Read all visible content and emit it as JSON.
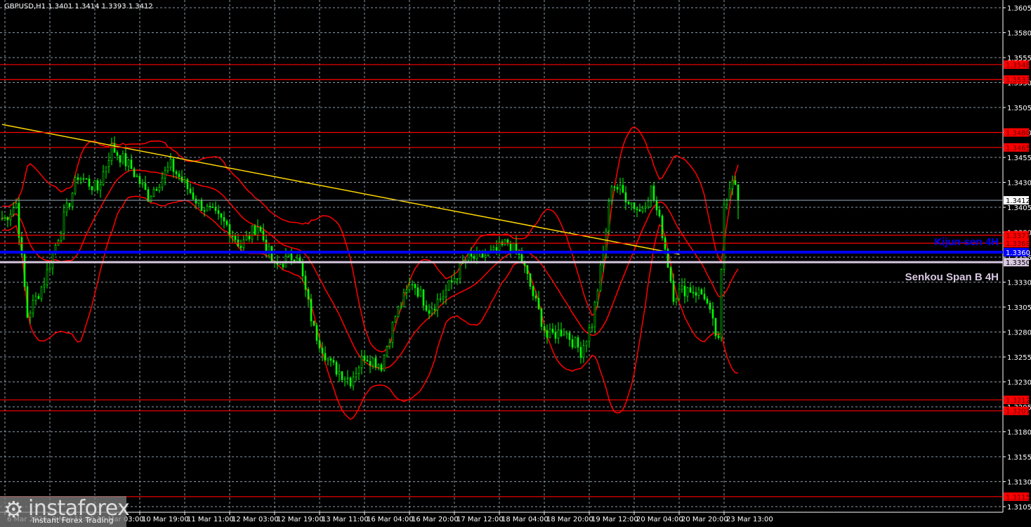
{
  "header": {
    "symbol_line": "GBPUSD,H1  1.3401 1.3414 1.3393 1.3412"
  },
  "logo": {
    "name": "instaforex",
    "tagline": "Instant Forex Trading"
  },
  "chart_data": {
    "type": "candlestick",
    "symbol": "GBPUSD",
    "timeframe": "H1",
    "ohlc_last": {
      "open": 1.3401,
      "high": 1.3414,
      "low": 1.3393,
      "close": 1.3412
    },
    "ylim": [
      1.3097,
      1.362
    ],
    "y_ticks": [
      "1.3605",
      "1.3580",
      "1.3555",
      "1.3530",
      "1.3505",
      "1.3480",
      "1.3455",
      "1.3430",
      "1.3405",
      "1.3380",
      "1.3355",
      "1.3330",
      "1.3305",
      "1.3280",
      "1.3255",
      "1.3230",
      "1.3205",
      "1.3180",
      "1.3155",
      "1.3130",
      "1.3105"
    ],
    "x_ticks": [
      "6 Mar 2026",
      "9 Mar 11:00",
      "10 Mar 03:00",
      "10 Mar 19:00",
      "11 Mar 11:00",
      "12 Mar 03:00",
      "12 Mar 19:00",
      "13 Mar 11:00",
      "16 Mar 04:00",
      "16 Mar 20:00",
      "17 Mar 12:00",
      "18 Mar 04:00",
      "18 Mar 20:00",
      "19 Mar 12:00",
      "20 Mar 04:00",
      "20 Mar 20:00",
      "23 Mar 13:00"
    ],
    "bars_per_x_tick": 16,
    "close_path_anchors": [
      [
        1,
        1.3394
      ],
      [
        5,
        1.3409
      ],
      [
        9,
        1.3296
      ],
      [
        15,
        1.3331
      ],
      [
        22,
        1.3394
      ],
      [
        27,
        1.3437
      ],
      [
        34,
        1.3423
      ],
      [
        39,
        1.3465
      ],
      [
        46,
        1.3444
      ],
      [
        52,
        1.3416
      ],
      [
        60,
        1.3447
      ],
      [
        70,
        1.3409
      ],
      [
        80,
        1.3387
      ],
      [
        85,
        1.3366
      ],
      [
        91,
        1.3387
      ],
      [
        97,
        1.3345
      ],
      [
        105,
        1.3359
      ],
      [
        111,
        1.3282
      ],
      [
        117,
        1.3247
      ],
      [
        124,
        1.3232
      ],
      [
        129,
        1.3257
      ],
      [
        135,
        1.3247
      ],
      [
        140,
        1.3296
      ],
      [
        146,
        1.3331
      ],
      [
        152,
        1.3303
      ],
      [
        157,
        1.3317
      ],
      [
        165,
        1.3352
      ],
      [
        175,
        1.3359
      ],
      [
        180,
        1.337
      ],
      [
        185,
        1.3352
      ],
      [
        189,
        1.3317
      ],
      [
        194,
        1.3275
      ],
      [
        200,
        1.3282
      ],
      [
        206,
        1.3261
      ],
      [
        210,
        1.3289
      ],
      [
        214,
        1.3359
      ],
      [
        217,
        1.343
      ],
      [
        222,
        1.3416
      ],
      [
        227,
        1.3401
      ],
      [
        231,
        1.3423
      ],
      [
        235,
        1.338
      ],
      [
        239,
        1.3317
      ],
      [
        244,
        1.3324
      ],
      [
        250,
        1.3317
      ],
      [
        255,
        1.3268
      ],
      [
        257,
        1.3409
      ],
      [
        260,
        1.3437
      ],
      [
        262,
        1.3412
      ]
    ],
    "trendline": {
      "color": "#FFD700",
      "from": [
        0,
        1.3488
      ],
      "to": [
        241,
        1.3358
      ]
    },
    "bollinger": {
      "period": 20,
      "deviations": 2,
      "color": "#FF0000"
    },
    "levels": [
      {
        "price": "1.3548",
        "color": "#FF0000"
      },
      {
        "price": "1.3533",
        "color": "#FF0000"
      },
      {
        "price": "1.3480",
        "color": "#FF0000"
      },
      {
        "price": "1.3465",
        "color": "#FF0000"
      },
      {
        "price": "1.3377",
        "color": "#FF0000"
      },
      {
        "price": "1.3369",
        "color": "#FF0000"
      },
      {
        "price": "1.3212",
        "color": "#FF0000"
      },
      {
        "price": "1.3201",
        "color": "#FF0000"
      },
      {
        "price": "1.3115",
        "color": "#FF0000"
      },
      {
        "price": "1.3360",
        "color": "#0000FF",
        "label": "Kijun-sen 4H"
      },
      {
        "price": "1.3350",
        "color": "#D8C8E0",
        "label": "Senkou Span B 4H"
      },
      {
        "price": "1.3412",
        "color": "#8899AA",
        "current": true
      }
    ],
    "colors": {
      "bull": "#00FF00",
      "bear": "#00FF00",
      "grid": "#8a9aa8",
      "axis": "#FFFFFF"
    }
  }
}
